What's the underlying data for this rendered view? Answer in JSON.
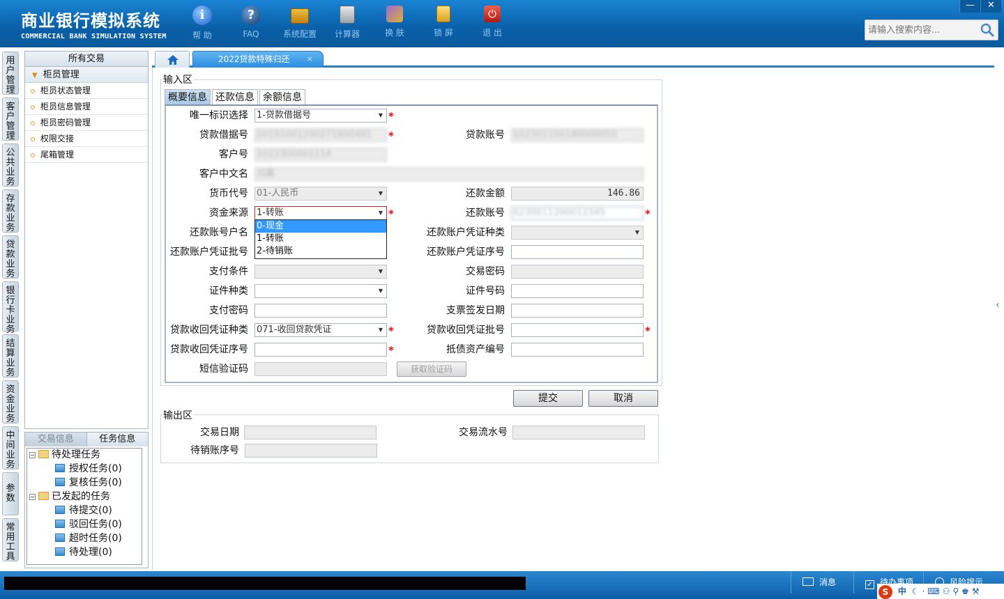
{
  "app": {
    "title_cn": "商业银行模拟系统",
    "title_en": "COMMERCIAL BANK SIMULATION SYSTEM"
  },
  "toolbar": [
    {
      "label": "帮 助",
      "icon": "info-icon"
    },
    {
      "label": "FAQ",
      "icon": "question-icon"
    },
    {
      "label": "系统配置",
      "icon": "toolbox-icon"
    },
    {
      "label": "计算器",
      "icon": "calculator-icon"
    },
    {
      "label": "换 肤",
      "icon": "shirt-icon"
    },
    {
      "label": "锁 屏",
      "icon": "lock-icon"
    },
    {
      "label": "退 出",
      "icon": "power-icon"
    }
  ],
  "window": {
    "minimize": "—",
    "close": "✕"
  },
  "search": {
    "placeholder": "请输入搜索内容..."
  },
  "vtabs": [
    "用户管理",
    "客户管理",
    "公共业务",
    "存款业务",
    "贷款业务",
    "银行卡业务",
    "结算业务",
    "资金业务",
    "中间业务",
    "参数",
    "常用工具"
  ],
  "tree": {
    "header": "所有交易",
    "group": "柜员管理",
    "items": [
      "柜员状态管理",
      "柜员信息管理",
      "柜员密码管理",
      "权限交接",
      "尾箱管理"
    ]
  },
  "tasks": {
    "tabs": [
      "交易信息",
      "任务信息"
    ],
    "pending": "待处理任务",
    "auth": "授权任务(0)",
    "review": "复核任务(0)",
    "initiated": "已发起的任务",
    "to_submit": "待提交(0)",
    "rejected": "驳回任务(0)",
    "timeout": "超时任务(0)",
    "to_process": "待处理(0)"
  },
  "tabs": {
    "active": "2022贷款特殊归还",
    "close": "×"
  },
  "input_area": {
    "title": "输入区",
    "subtabs": [
      "概要信息",
      "还款信息",
      "余额信息"
    ]
  },
  "form": {
    "unique_id_label": "唯一标识选择",
    "unique_id_value": "1-贷款借据号",
    "loan_note_label": "贷款借据号",
    "loan_note_value": "20191001200271800491",
    "loan_account_label": "贷款账号",
    "loan_account_value": "102301100180000050",
    "customer_no_label": "客户号",
    "customer_no_value": "1022300001114",
    "customer_name_label": "客户中文名",
    "customer_name_value": "刘晨",
    "currency_label": "货币代号",
    "currency_value": "01-人民币",
    "repay_amount_label": "还款金额",
    "repay_amount_value": "146.86",
    "fund_source_label": "资金来源",
    "fund_source_value": "1-转账",
    "repay_account_label": "还款账号",
    "repay_account_value": "6230011200012345",
    "repay_holder_label": "还款账号户名",
    "repay_voucher_type_label": "还款账户凭证种类",
    "repay_voucher_batch_label": "还款账户凭证批号",
    "repay_voucher_seq_label": "还款账户凭证序号",
    "pay_condition_label": "支付条件",
    "trade_password_label": "交易密码",
    "id_type_label": "证件种类",
    "id_no_label": "证件号码",
    "pay_password_label": "支付密码",
    "check_date_label": "支票签发日期",
    "recover_voucher_type_label": "贷款收回凭证种类",
    "recover_voucher_type_value": "071-收回贷款凭证",
    "recover_voucher_batch_label": "贷款收回凭证批号",
    "recover_voucher_seq_label": "贷款收回凭证序号",
    "collateral_no_label": "抵债资产编号",
    "sms_code_label": "短信验证码",
    "get_code_button": "获取验证码",
    "required_mark": "*"
  },
  "dropdown": {
    "options": [
      "0-现金",
      "1-转账",
      "2-待销账"
    ],
    "selected_index": 0
  },
  "actions": {
    "submit": "提交",
    "cancel": "取消"
  },
  "output_area": {
    "title": "输出区",
    "trade_date_label": "交易日期",
    "serial_no_label": "交易流水号",
    "pending_account_label": "待销账序号"
  },
  "status": {
    "message": "消息",
    "todo": "待办事项",
    "risk": "风险提示"
  },
  "ime": {
    "text": "中"
  }
}
